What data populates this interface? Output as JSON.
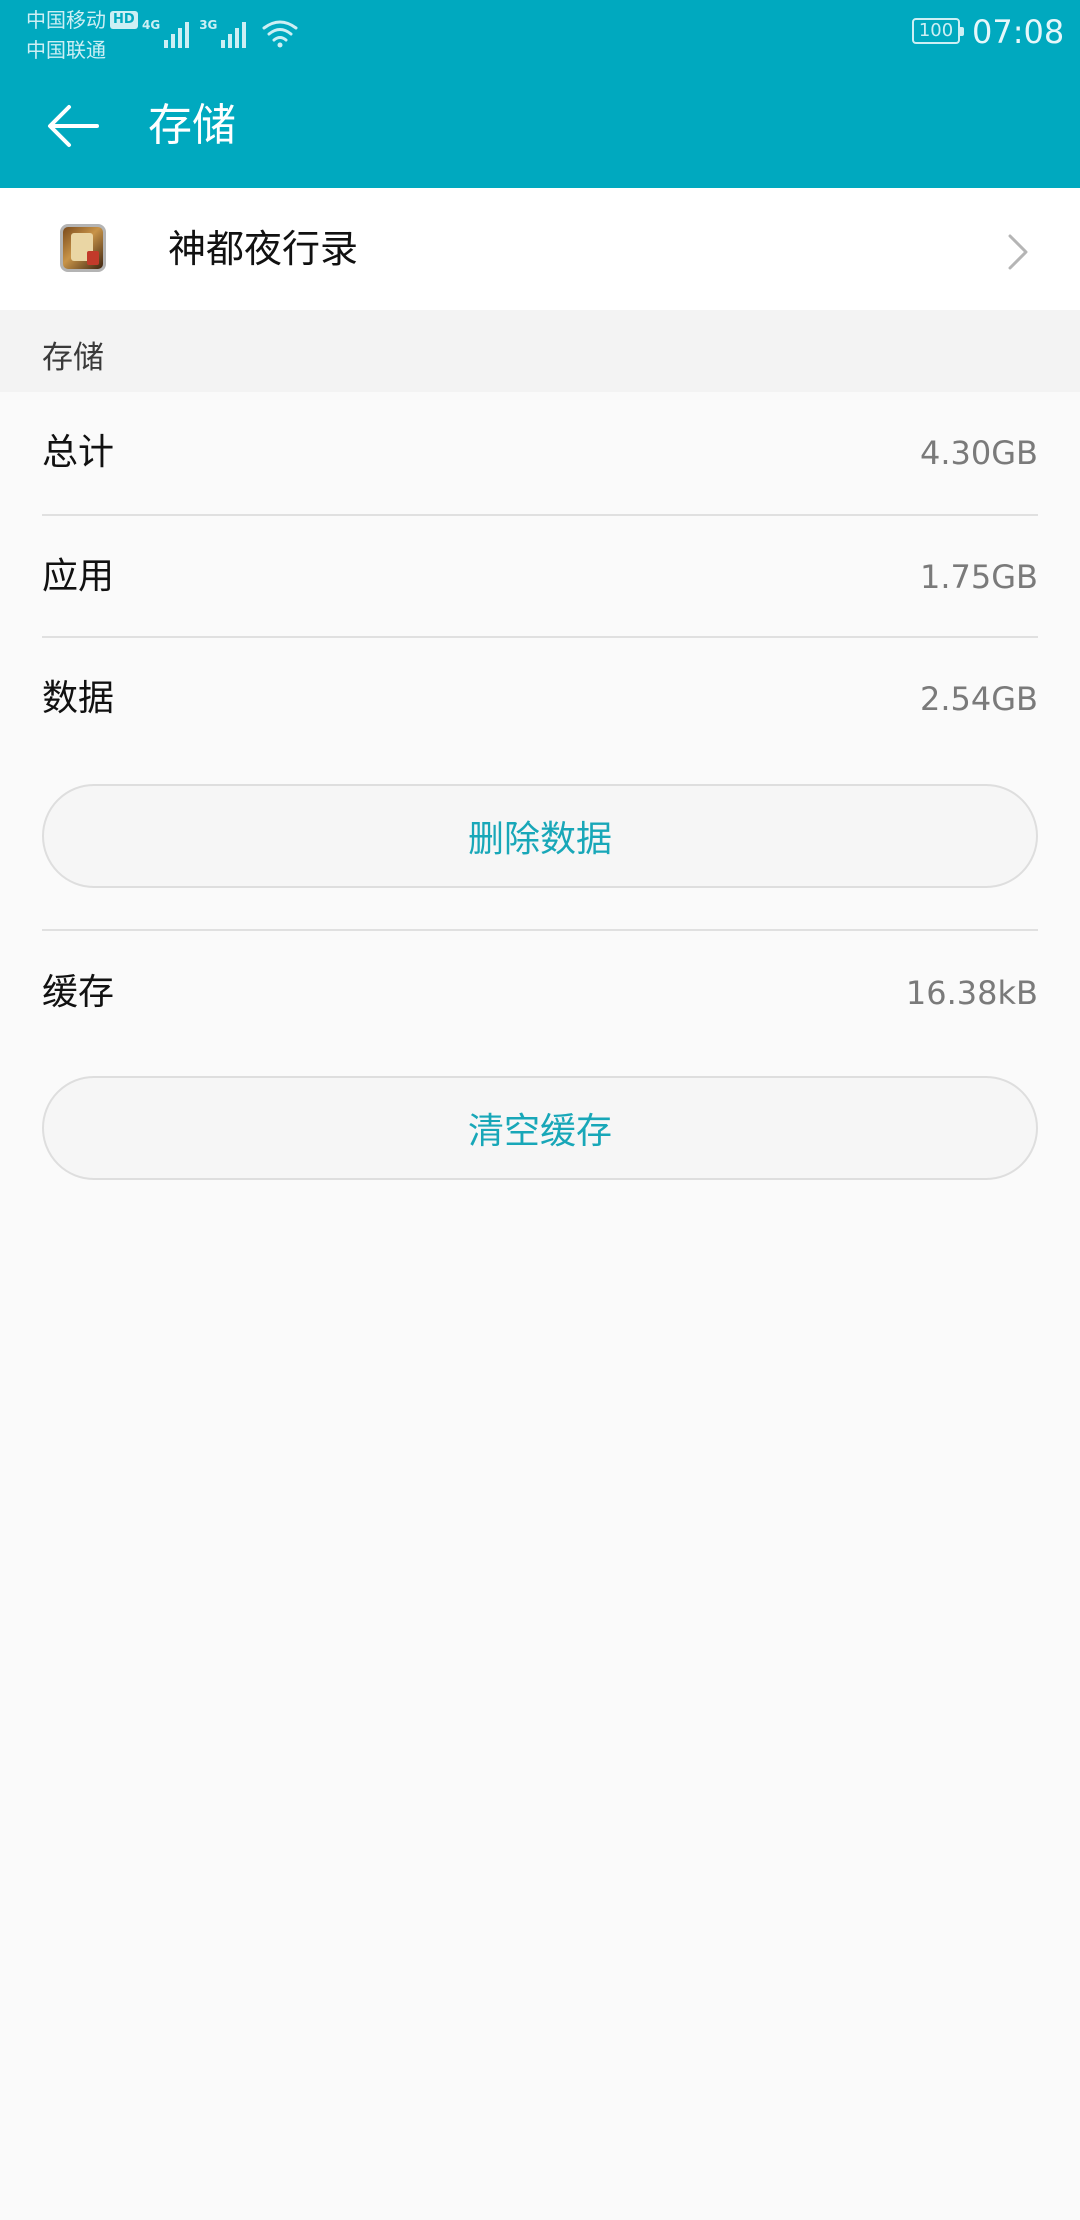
{
  "status_bar": {
    "carrier_1": "中国移动",
    "hd_badge": "HD",
    "carrier_2": "中国联通",
    "network_1": "4G",
    "network_2": "3G",
    "battery": "100",
    "time": "07:08",
    "icons": [
      "signal-icon",
      "wifi-icon",
      "battery-icon"
    ]
  },
  "toolbar": {
    "back_icon": "back-arrow-icon",
    "title": "存储"
  },
  "app": {
    "name": "神都夜行录",
    "icon": "app-icon",
    "chevron_icon": "chevron-right-icon"
  },
  "section": {
    "title": "存储"
  },
  "storage": {
    "total": {
      "label": "总计",
      "value": "4.30GB"
    },
    "app": {
      "label": "应用",
      "value": "1.75GB"
    },
    "data": {
      "label": "数据",
      "value": "2.54GB"
    },
    "clear_data_label": "删除数据",
    "cache": {
      "label": "缓存",
      "value": "16.38kB"
    },
    "clear_cache_label": "清空缓存"
  },
  "colors": {
    "header_bg": "#00a9bf",
    "accent_text": "#18a7b8",
    "page_bg": "#fafafa"
  }
}
